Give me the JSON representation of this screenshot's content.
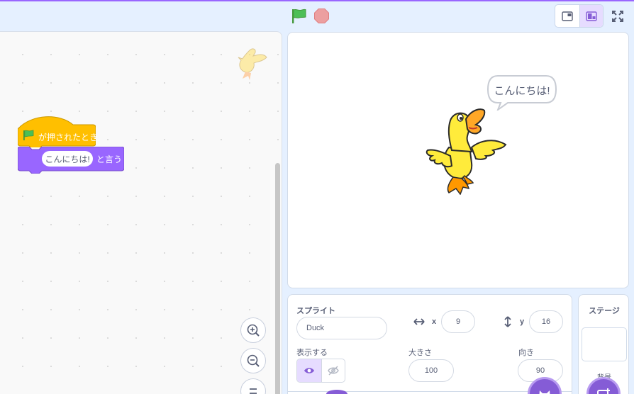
{
  "toolbar": {
    "green_flag_icon": "green-flag-icon",
    "stop_icon": "stop-sign-icon",
    "small_stage_icon": "small-stage-icon",
    "normal_stage_icon": "normal-stage-icon",
    "fullscreen_icon": "fullscreen-icon"
  },
  "code": {
    "hat_block_label": "が押されたとき",
    "say_input_value": "こんにちは!",
    "say_block_label": "と言う"
  },
  "stage": {
    "speech_bubble_text": "こんにちは!"
  },
  "sprite_info": {
    "title": "スプライト",
    "name_value": "Duck",
    "x_label": "x",
    "x_value": "9",
    "y_label": "y",
    "y_value": "16",
    "show_label": "表示する",
    "size_label": "大きさ",
    "size_value": "100",
    "direction_label": "向き",
    "direction_value": "90"
  },
  "stage_selector": {
    "title": "ステージ",
    "backdrop_label": "背景"
  },
  "colors": {
    "accent": "#855cd6",
    "events_block": "#ffbf00",
    "looks_block": "#9966ff",
    "green_flag": "#4cbf56",
    "stop": "#ec5959"
  }
}
